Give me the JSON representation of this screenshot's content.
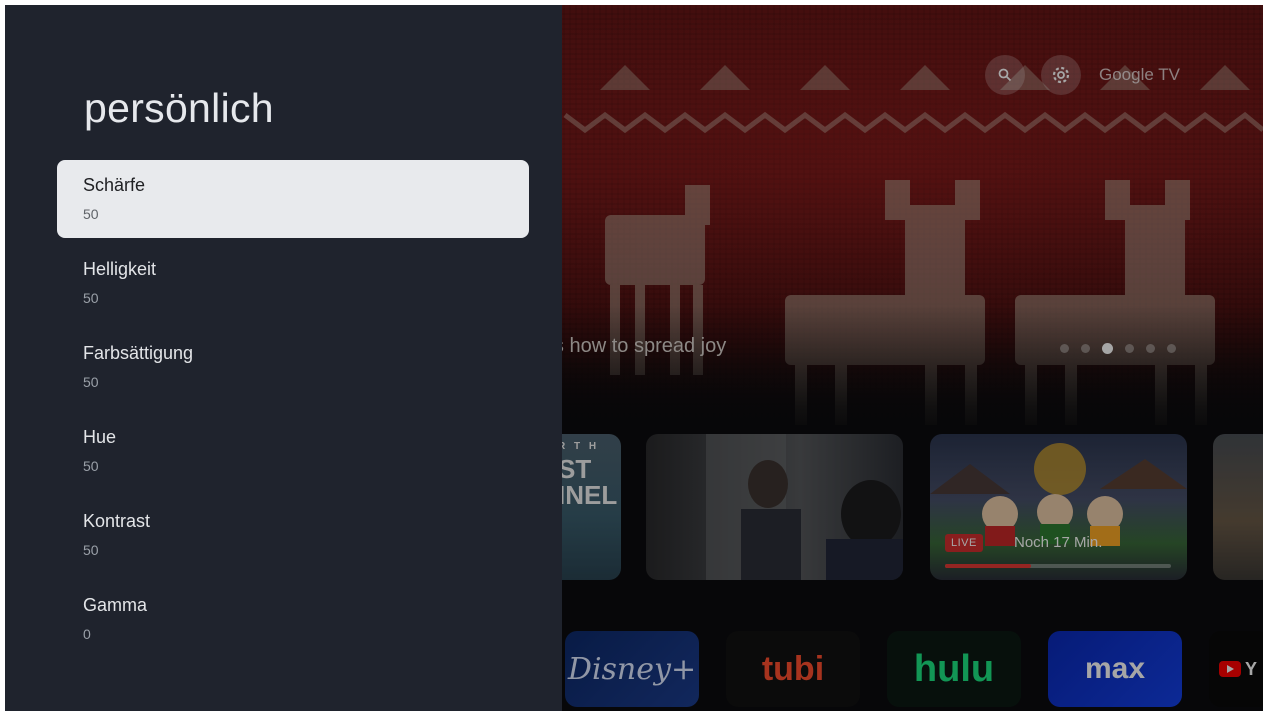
{
  "panel": {
    "title": "persönlich",
    "settings": [
      {
        "label": "Schärfe",
        "value": "50",
        "focused": true
      },
      {
        "label": "Helligkeit",
        "value": "50",
        "focused": false
      },
      {
        "label": "Farbsättigung",
        "value": "50",
        "focused": false
      },
      {
        "label": "Hue",
        "value": "50",
        "focused": false
      },
      {
        "label": "Kontrast",
        "value": "50",
        "focused": false
      },
      {
        "label": "Gamma",
        "value": "0",
        "focused": false
      }
    ]
  },
  "background": {
    "brand_label": "Google TV",
    "hero_caption": "arns how to spread joy",
    "carousel": {
      "count": 6,
      "active": 2
    },
    "topbar_icons": [
      "search-icon",
      "gear-icon"
    ],
    "tiles": [
      {
        "name": "planet-earth-tile",
        "text_top": "R T H",
        "text_main": "ST\nINEL"
      },
      {
        "name": "drama-tile"
      },
      {
        "name": "south-park-live-tile",
        "badge": "LIVE",
        "remaining": "Noch 17 Min.",
        "progress": 0.38
      },
      {
        "name": "disaster-tile"
      }
    ],
    "apps": [
      {
        "name": "disney-plus",
        "label": "Disney+"
      },
      {
        "name": "tubi",
        "label": "tubi"
      },
      {
        "name": "hulu",
        "label": "hulu"
      },
      {
        "name": "max",
        "label": "max"
      },
      {
        "name": "youtube",
        "label": "Y"
      }
    ]
  },
  "colors": {
    "panel_bg": "#1f232d",
    "focused_row_bg": "#e8eaed",
    "hulu_green": "#1ce783",
    "tubi_orange": "#ff4f2f",
    "live_red": "#d32f2f"
  }
}
